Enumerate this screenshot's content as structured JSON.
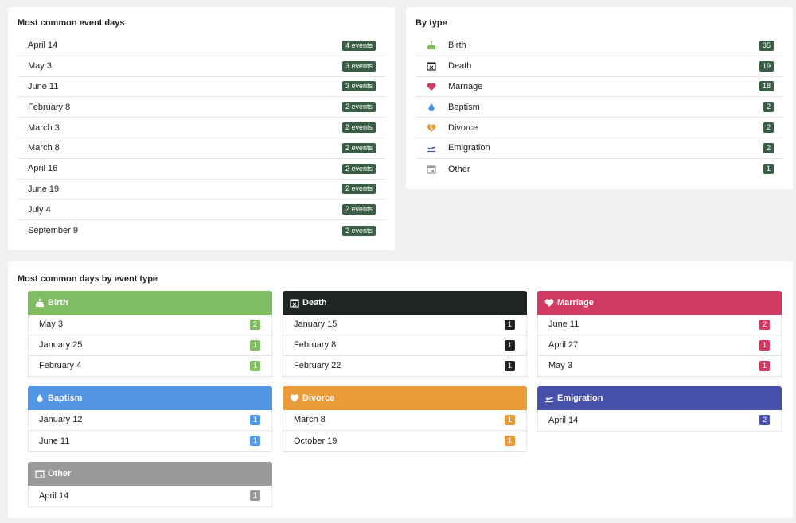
{
  "common_days": {
    "title": "Most common event days",
    "rows": [
      {
        "date": "April 14",
        "count": "4 events"
      },
      {
        "date": "May 3",
        "count": "3 events"
      },
      {
        "date": "June 11",
        "count": "3 events"
      },
      {
        "date": "February 8",
        "count": "2 events"
      },
      {
        "date": "March 3",
        "count": "2 events"
      },
      {
        "date": "March 8",
        "count": "2 events"
      },
      {
        "date": "April 16",
        "count": "2 events"
      },
      {
        "date": "June 19",
        "count": "2 events"
      },
      {
        "date": "July 4",
        "count": "2 events"
      },
      {
        "date": "September 9",
        "count": "2 events"
      }
    ]
  },
  "by_type": {
    "title": "By type",
    "rows": [
      {
        "label": "Birth",
        "count": "35",
        "icon": "birth-cake-icon",
        "color": "#7dbb5c"
      },
      {
        "label": "Death",
        "count": "19",
        "icon": "calendar-x-icon",
        "color": "#222222"
      },
      {
        "label": "Marriage",
        "count": "18",
        "icon": "heart-icon",
        "color": "#d03a63"
      },
      {
        "label": "Baptism",
        "count": "2",
        "icon": "water-drop-icon",
        "color": "#4a90e2"
      },
      {
        "label": "Divorce",
        "count": "2",
        "icon": "broken-heart-icon",
        "color": "#e89b36"
      },
      {
        "label": "Emigration",
        "count": "2",
        "icon": "airplane-departure-icon",
        "color": "#4650a8"
      },
      {
        "label": "Other",
        "count": "1",
        "icon": "calendar-icon",
        "color": "#999999"
      }
    ]
  },
  "by_event_type": {
    "title": "Most common days by event type",
    "groups": [
      {
        "name": "Birth",
        "color": "#80bc62",
        "icon": "birth-cake-icon",
        "rows": [
          {
            "date": "May 3",
            "count": "2"
          },
          {
            "date": "January 25",
            "count": "1"
          },
          {
            "date": "February 4",
            "count": "1"
          }
        ]
      },
      {
        "name": "Death",
        "color": "#1f2622",
        "icon": "calendar-x-icon",
        "rows": [
          {
            "date": "January 15",
            "count": "1"
          },
          {
            "date": "February 8",
            "count": "1"
          },
          {
            "date": "February 22",
            "count": "1"
          }
        ]
      },
      {
        "name": "Marriage",
        "color": "#d13a62",
        "icon": "heart-icon",
        "rows": [
          {
            "date": "June 11",
            "count": "2"
          },
          {
            "date": "April 27",
            "count": "1"
          },
          {
            "date": "May 3",
            "count": "1"
          }
        ]
      },
      {
        "name": "Baptism",
        "color": "#5496e6",
        "icon": "water-drop-icon",
        "rows": [
          {
            "date": "January 12",
            "count": "1"
          },
          {
            "date": "June 11",
            "count": "1"
          }
        ]
      },
      {
        "name": "Divorce",
        "color": "#ea9b38",
        "icon": "broken-heart-icon",
        "rows": [
          {
            "date": "March 8",
            "count": "1"
          },
          {
            "date": "October 19",
            "count": "1"
          }
        ]
      },
      {
        "name": "Emigration",
        "color": "#4650a8",
        "icon": "airplane-departure-icon",
        "rows": [
          {
            "date": "April 14",
            "count": "2"
          }
        ]
      },
      {
        "name": "Other",
        "color": "#9a9a9a",
        "icon": "calendar-icon",
        "rows": [
          {
            "date": "April 14",
            "count": "1"
          }
        ]
      }
    ]
  }
}
